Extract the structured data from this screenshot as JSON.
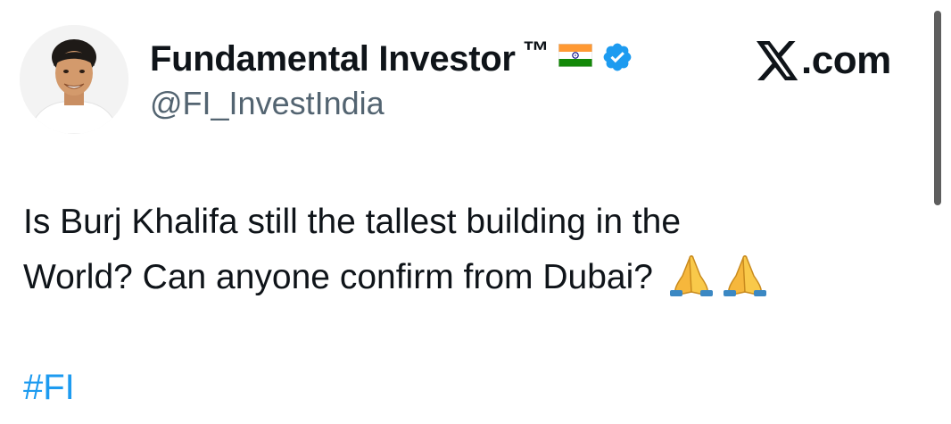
{
  "profile": {
    "display_name": "Fundamental Investor",
    "trademark": "™",
    "flag_icon": "india-flag-icon",
    "verified_icon": "verified-badge-icon",
    "verified_color": "#1d9bf0",
    "handle": "@FI_InvestIndia",
    "avatar_icon": "profile-avatar"
  },
  "brand": {
    "logo_icon": "x-logo-icon",
    "text": ".com"
  },
  "tweet": {
    "line1": "Is Burj Khalifa still the tallest building in the",
    "line2": "World? Can anyone confirm from Dubai?",
    "emoji": [
      "folded-hands-emoji",
      "folded-hands-emoji"
    ],
    "hashtag": "#FI",
    "hashtag_color": "#1d9bf0"
  }
}
